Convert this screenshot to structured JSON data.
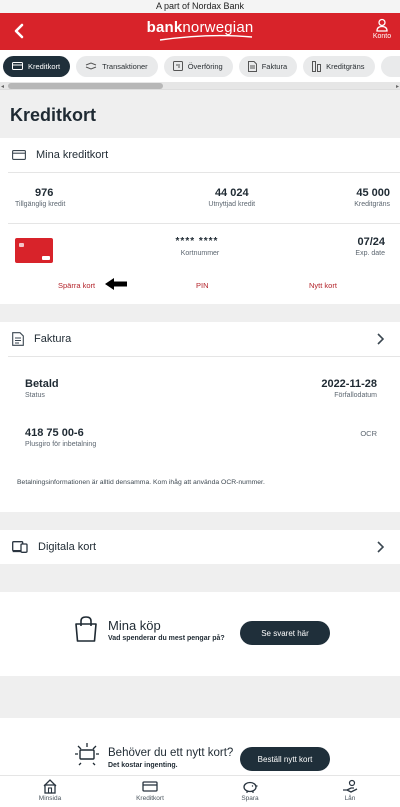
{
  "top_banner": "A part of Nordax Bank",
  "header": {
    "brand_bold": "bank",
    "brand_light": "norwegian",
    "account_label": "Konto"
  },
  "tabs": [
    {
      "label": "Kreditkort"
    },
    {
      "label": "Transaktioner"
    },
    {
      "label": "Överföring"
    },
    {
      "label": "Faktura"
    },
    {
      "label": "Kreditgräns"
    }
  ],
  "page_title": "Kreditkort",
  "cards_section": {
    "title": "Mina kreditkort",
    "stats": [
      {
        "value": "976",
        "label": "Tillgänglig kredit"
      },
      {
        "value": "44 024",
        "label": "Utnyttjad kredit"
      },
      {
        "value": "45 000",
        "label": "Kreditgräns"
      }
    ],
    "card_number": "**** ****",
    "card_number_label": "Kortnummer",
    "expiry": "07/24",
    "expiry_label": "Exp. date",
    "actions": {
      "block": "Spärra kort",
      "pin": "PIN",
      "new": "Nytt kort"
    }
  },
  "invoice_section": {
    "title": "Faktura",
    "status_value": "Betald",
    "status_label": "Status",
    "due_value": "2022-11-28",
    "due_label": "Förfallodatum",
    "account_value": "418 75 00-6",
    "account_label": "Plusgiro för inbetalning",
    "ocr_label": "OCR",
    "info_text": "Betalningsinformationen är alltid densamma. Kom ihåg att använda OCR-nummer."
  },
  "digital_cards": {
    "title": "Digitala kort"
  },
  "purchases_promo": {
    "title": "Mina köp",
    "subtitle": "Vad spenderar du mest pengar på?",
    "button": "Se svaret här"
  },
  "newcard_promo": {
    "title": "Behöver du ett nytt kort?",
    "subtitle": "Det kostar ingenting.",
    "button": "Beställ nytt kort"
  },
  "bottom_nav": [
    {
      "label": "Minsida"
    },
    {
      "label": "Kreditkort"
    },
    {
      "label": "Spara"
    },
    {
      "label": "Lån"
    }
  ],
  "colors": {
    "brand_red": "#d8232a",
    "dark_navy": "#1f2f3a",
    "action_red": "#b3232a"
  }
}
